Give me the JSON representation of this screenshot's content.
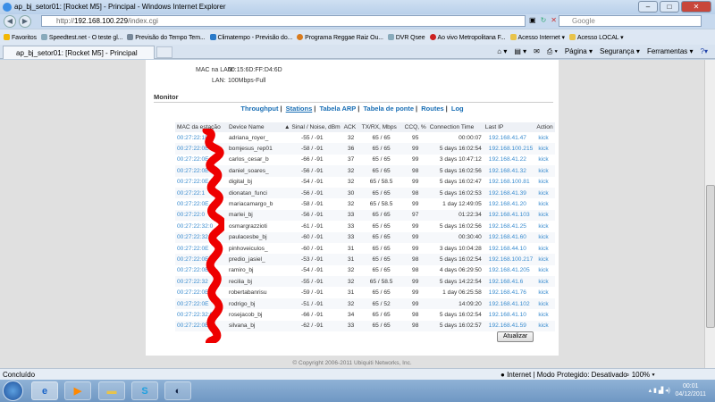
{
  "window": {
    "title": "ap_bj_setor01: [Rocket M5] - Principal - Windows Internet Explorer",
    "url_prefix": "http://",
    "url_host": "192.168.100.229",
    "url_path": "/index.cgi",
    "search_placeholder": "Google"
  },
  "favorites": {
    "label": "Favoritos",
    "items": [
      "Speedtest.net - O teste gl...",
      "Previsão do Tempo  Tem...",
      "Climatempo - Previsão do...",
      "Programa Reggae Raiz Ou...",
      "DVR Qsee",
      "Ao vivo  Metropolitana F...",
      "Acesso Internet ▾",
      "Acesso LOCAL ▾"
    ]
  },
  "tab": {
    "label": "ap_bj_setor01: [Rocket M5] - Principal"
  },
  "commandbar": [
    "Página ▾",
    "Segurança ▾",
    "Ferramentas ▾"
  ],
  "info": {
    "mac_label": "MAC na LAN:",
    "mac_value": "00:15:6D:FF:D4:6D",
    "lan_label": "LAN:",
    "lan_value": "100Mbps-Full"
  },
  "monitor": {
    "title": "Monitor",
    "tabs": [
      "Throughput",
      "Stations",
      "Tabela ARP",
      "Tabela de ponte",
      "Routes",
      "Log"
    ],
    "active_tab": "Stations"
  },
  "table": {
    "headers": [
      "MAC da estação",
      "Device Name",
      "▲ Sinal / Noise, dBm",
      "ACK",
      "TX/RX, Mbps",
      "CCQ, %",
      "Connection Time",
      "Last IP",
      "Action"
    ],
    "rows": [
      [
        "00:27:22:1E",
        "adriana_royer_",
        "-55 / -91",
        "32",
        "65 / 65",
        "95",
        "00:00:07",
        "192.168.41.47",
        "kick"
      ],
      [
        "00:27:22:0E",
        "bomjesus_rep01",
        "-58 / -91",
        "36",
        "65 / 65",
        "99",
        "5 days 16:02:54",
        "192.168.100.215",
        "kick"
      ],
      [
        "00:27:22:0E",
        "carlos_cesar_b",
        "-66 / -91",
        "37",
        "65 / 65",
        "99",
        "3 days 10:47:12",
        "192.168.41.22",
        "kick"
      ],
      [
        "00:27:22:0E",
        "daniel_soares_",
        "-56 / -91",
        "32",
        "65 / 65",
        "98",
        "5 days 16:02:56",
        "192.168.41.32",
        "kick"
      ],
      [
        "00:27:22:0E",
        "digital_bj",
        "-54 / -91",
        "32",
        "65 / 58.5",
        "99",
        "5 days 16:02:47",
        "192.168.100.81",
        "kick"
      ],
      [
        "00:27:22:1",
        "dionatan_funci",
        "-56 / -91",
        "30",
        "65 / 65",
        "98",
        "5 days 16:02:53",
        "192.168.41.39",
        "kick"
      ],
      [
        "00:27:22:0E",
        "mariacamargo_b",
        "-58 / -91",
        "32",
        "65 / 58.5",
        "99",
        "1 day 12:49:05",
        "192.168.41.20",
        "kick"
      ],
      [
        "00:27:22:0",
        "marlei_bj",
        "-56 / -91",
        "33",
        "65 / 65",
        "97",
        "01:22:34",
        "192.168.41.103",
        "kick"
      ],
      [
        "00:27:22:32:0",
        "osmargrazzioti",
        "-61 / -91",
        "33",
        "65 / 65",
        "99",
        "5 days 16:02:56",
        "192.168.41.25",
        "kick"
      ],
      [
        "00:27:22:32:0",
        "paulacesbe_bj",
        "-60 / -91",
        "33",
        "65 / 65",
        "99",
        "00:30:40",
        "192.168.41.60",
        "kick"
      ],
      [
        "00:27:22:0E",
        "pinhoveiculos_",
        "-60 / -91",
        "31",
        "65 / 65",
        "99",
        "3 days 10:04:28",
        "192.168.44.10",
        "kick"
      ],
      [
        "00:27:22:0E",
        "predio_jasiel_",
        "-53 / -91",
        "31",
        "65 / 65",
        "98",
        "5 days 16:02:54",
        "192.168.100.217",
        "kick"
      ],
      [
        "00:27:22:0E",
        "ramiro_bj",
        "-54 / -91",
        "32",
        "65 / 65",
        "98",
        "4 days 06:29:50",
        "192.168.41.205",
        "kick"
      ],
      [
        "00:27:22:32",
        "recilia_bj",
        "-55 / -91",
        "32",
        "65 / 58.5",
        "99",
        "5 days 14:22:54",
        "192.168.41.6",
        "kick"
      ],
      [
        "00:27:22:0E",
        "robertabanrisu",
        "-59 / -91",
        "31",
        "65 / 65",
        "99",
        "1 day 06:25:58",
        "192.168.41.76",
        "kick"
      ],
      [
        "00:27:22:0E",
        "rodrigo_bj",
        "-51 / -91",
        "32",
        "65 / 52",
        "99",
        "14:09:20",
        "192.168.41.102",
        "kick"
      ],
      [
        "00:27:22:32:0",
        "rosejacob_bj",
        "-66 / -91",
        "34",
        "65 / 65",
        "98",
        "5 days 16:02:54",
        "192.168.41.10",
        "kick"
      ],
      [
        "00:27:22:0E",
        "silvana_bj",
        "-62 / -91",
        "33",
        "65 / 65",
        "98",
        "5 days 16:02:57",
        "192.168.41.59",
        "kick"
      ]
    ]
  },
  "refresh_button": "Atualizar",
  "copyright": "© Copyright 2006-2011 Ubiquiti Networks, Inc.",
  "statusbar": {
    "left": "Concluído",
    "zone": "Internet | Modo Protegido: Desativado",
    "zoom": "100%"
  },
  "taskbar": {
    "time": "00:01",
    "date": "04/12/2011"
  }
}
